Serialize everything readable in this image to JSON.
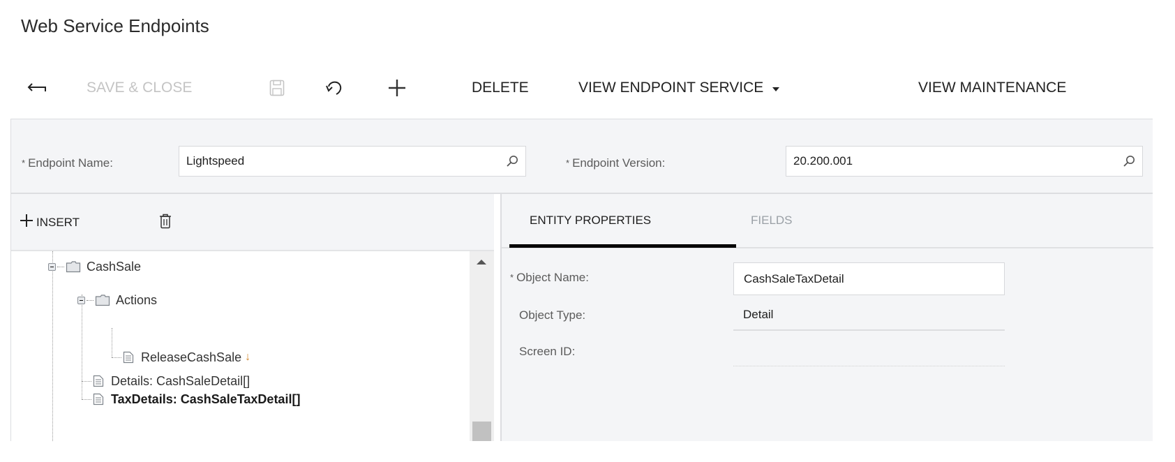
{
  "page": {
    "title": "Web Service Endpoints"
  },
  "toolbar": {
    "back_icon": "back-arrow-icon",
    "save_close_label": "SAVE & CLOSE",
    "save_icon": "save-icon",
    "undo_icon": "undo-icon",
    "add_icon": "plus-icon",
    "delete_label": "DELETE",
    "view_endpoint_service_label": "VIEW ENDPOINT SERVICE",
    "view_endpoint_service_icon": "caret-down-icon",
    "view_maintenance_label": "VIEW MAINTENANCE"
  },
  "form": {
    "endpoint_name": {
      "label": "Endpoint Name:",
      "required_mark": "*",
      "value": "Lightspeed",
      "icon": "search-icon"
    },
    "endpoint_version": {
      "label": "Endpoint Version:",
      "required_mark": "*",
      "value": "20.200.001",
      "icon": "search-icon"
    }
  },
  "tree_panel": {
    "insert_label": "INSERT",
    "insert_icon": "plus-icon",
    "delete_icon": "trash-icon",
    "nodes": [
      {
        "label": "CashSale",
        "type": "folder",
        "expanded": true,
        "level": 1
      },
      {
        "label": "Actions",
        "type": "folder",
        "expanded": true,
        "level": 2
      },
      {
        "label": "ReleaseCashSale",
        "type": "item",
        "level": 3,
        "suffix": "↓"
      },
      {
        "label": "Details: CashSaleDetail[]",
        "type": "item",
        "level": 2
      },
      {
        "label": "TaxDetails: CashSaleTaxDetail[]",
        "type": "item",
        "level": 2,
        "selected": true
      }
    ]
  },
  "details_panel": {
    "tabs": [
      {
        "label": "ENTITY PROPERTIES",
        "active": true
      },
      {
        "label": "FIELDS",
        "active": false
      }
    ],
    "fields": {
      "object_name": {
        "label": "Object Name:",
        "required_mark": "*",
        "value": "CashSaleTaxDetail"
      },
      "object_type": {
        "label": "Object Type:",
        "value": "Detail"
      },
      "screen_id": {
        "label": "Screen ID:",
        "value": ""
      }
    }
  }
}
